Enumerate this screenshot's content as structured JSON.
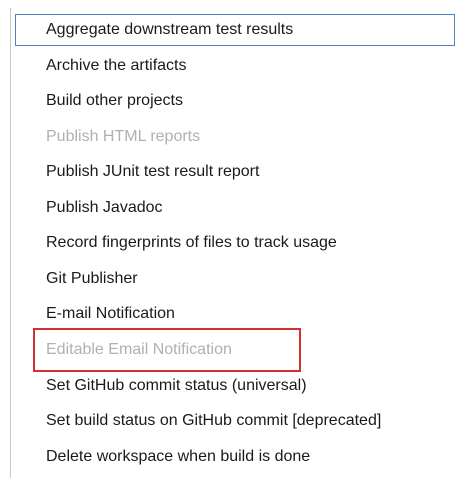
{
  "menu": {
    "items": [
      {
        "label": "Aggregate downstream test results",
        "enabled": true,
        "selected": true
      },
      {
        "label": "Archive the artifacts",
        "enabled": true,
        "selected": false
      },
      {
        "label": "Build other projects",
        "enabled": true,
        "selected": false
      },
      {
        "label": "Publish HTML reports",
        "enabled": false,
        "selected": false
      },
      {
        "label": "Publish JUnit test result report",
        "enabled": true,
        "selected": false
      },
      {
        "label": "Publish Javadoc",
        "enabled": true,
        "selected": false
      },
      {
        "label": "Record fingerprints of files to track usage",
        "enabled": true,
        "selected": false
      },
      {
        "label": "Git Publisher",
        "enabled": true,
        "selected": false
      },
      {
        "label": "E-mail Notification",
        "enabled": true,
        "selected": false
      },
      {
        "label": "Editable Email Notification",
        "enabled": false,
        "selected": false
      },
      {
        "label": "Set GitHub commit status (universal)",
        "enabled": true,
        "selected": false
      },
      {
        "label": "Set build status on GitHub commit [deprecated]",
        "enabled": true,
        "selected": false
      },
      {
        "label": "Delete workspace when build is done",
        "enabled": true,
        "selected": false
      }
    ]
  },
  "colors": {
    "text": "#1a1a1a",
    "disabled_text": "#b0b0b0",
    "selection_border": "#4d84c9",
    "highlight_border": "#d32f2f"
  }
}
